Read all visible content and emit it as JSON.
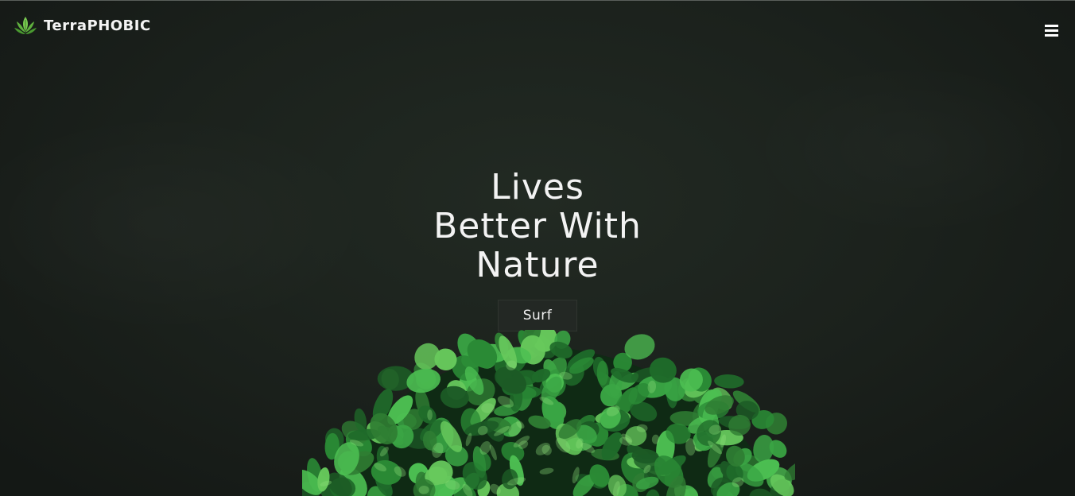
{
  "brand": {
    "name": "TerraPHOBIC",
    "logo_icon": "leaf-lotus-icon",
    "logo_color": "#6cc04a"
  },
  "nav": {
    "menu_icon": "hamburger-menu-icon"
  },
  "hero": {
    "headline_lines": [
      "Lives",
      "Better With",
      "Nature"
    ],
    "button_label": "Surf",
    "background_color": "#1b211c",
    "plant_icon": "green-plant-bush-image"
  }
}
